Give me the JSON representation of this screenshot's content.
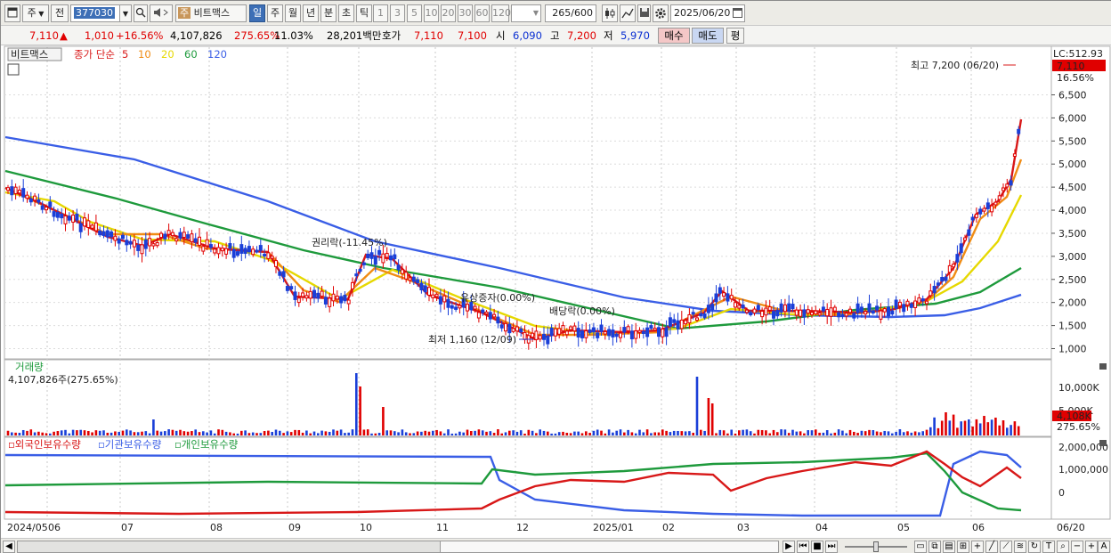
{
  "toolbar": {
    "period_select": "주",
    "prev_label": "전",
    "code": "377030",
    "stock_badge": "주",
    "stock_name": "비트맥스",
    "period_tabs": [
      "일",
      "주",
      "월",
      "년",
      "분",
      "초",
      "틱"
    ],
    "active_period": "일",
    "interval_tabs": [
      "1",
      "3",
      "5",
      "10",
      "20",
      "30",
      "60",
      "120"
    ],
    "count": "265",
    "count_total": "/600",
    "date": "2025/06/20"
  },
  "info": {
    "price": "7,110",
    "change_arrow": "▲",
    "change": "1,010",
    "change_pct": "+16.56%",
    "volume": "4,107,826",
    "volume_ratio": "275.65%",
    "turnover": "11.03%",
    "amount": "28,201백만",
    "quote_label": "호가",
    "ask": "7,110",
    "bid": "7,100",
    "open_label": "시",
    "open": "6,090",
    "high_label": "고",
    "high": "7,200",
    "low_label": "저",
    "low": "5,970",
    "buy_label": "매수",
    "sell_label": "매도",
    "eval_label": "평"
  },
  "price_panel": {
    "stock_label": "비트맥스",
    "ma_prefix": "종가 단순",
    "ma_periods": [
      "5",
      "10",
      "20",
      "60",
      "120"
    ],
    "ma_colors": [
      "#d81818",
      "#f08c14",
      "#e6d800",
      "#1e9a3c",
      "#3a5ee6"
    ],
    "lc_label": "LC:512.93",
    "current_price_tag": "7,110",
    "current_pct_tag": "16.56%",
    "y_ticks": [
      "6,500",
      "6,000",
      "5,500",
      "5,000",
      "4,500",
      "4,000",
      "3,500",
      "3,000",
      "2,500",
      "2,000",
      "1,500",
      "1,000"
    ],
    "annotations": {
      "high": "최고 7,200 (06/20)",
      "low": "최저 1,160 (12/09)",
      "rights": "권리락(-11.45%)",
      "paid_in": "유상증자(0.00%)",
      "dividend": "배당락(0.00%)"
    }
  },
  "volume_panel": {
    "title": "거래량",
    "value": "4,107,826주(275.65%)",
    "y_ticks": [
      "10,000K",
      "5,000K"
    ],
    "current_tag": "4,108K",
    "current_pct": "275.65%"
  },
  "holdings_panel": {
    "series": [
      "외국인보유수량",
      "기관보유수량",
      "개인보유수량"
    ],
    "series_colors": [
      "#d81818",
      "#3a5ee6",
      "#1e9a3c"
    ],
    "y_ticks": [
      "2,000,000",
      "1,000,000",
      "0"
    ]
  },
  "x_axis": {
    "labels": [
      "2024/05",
      "06",
      "07",
      "08",
      "09",
      "10",
      "11",
      "12",
      "2025/01",
      "02",
      "03",
      "04",
      "05",
      "06"
    ],
    "end_label": "06/20"
  }
}
